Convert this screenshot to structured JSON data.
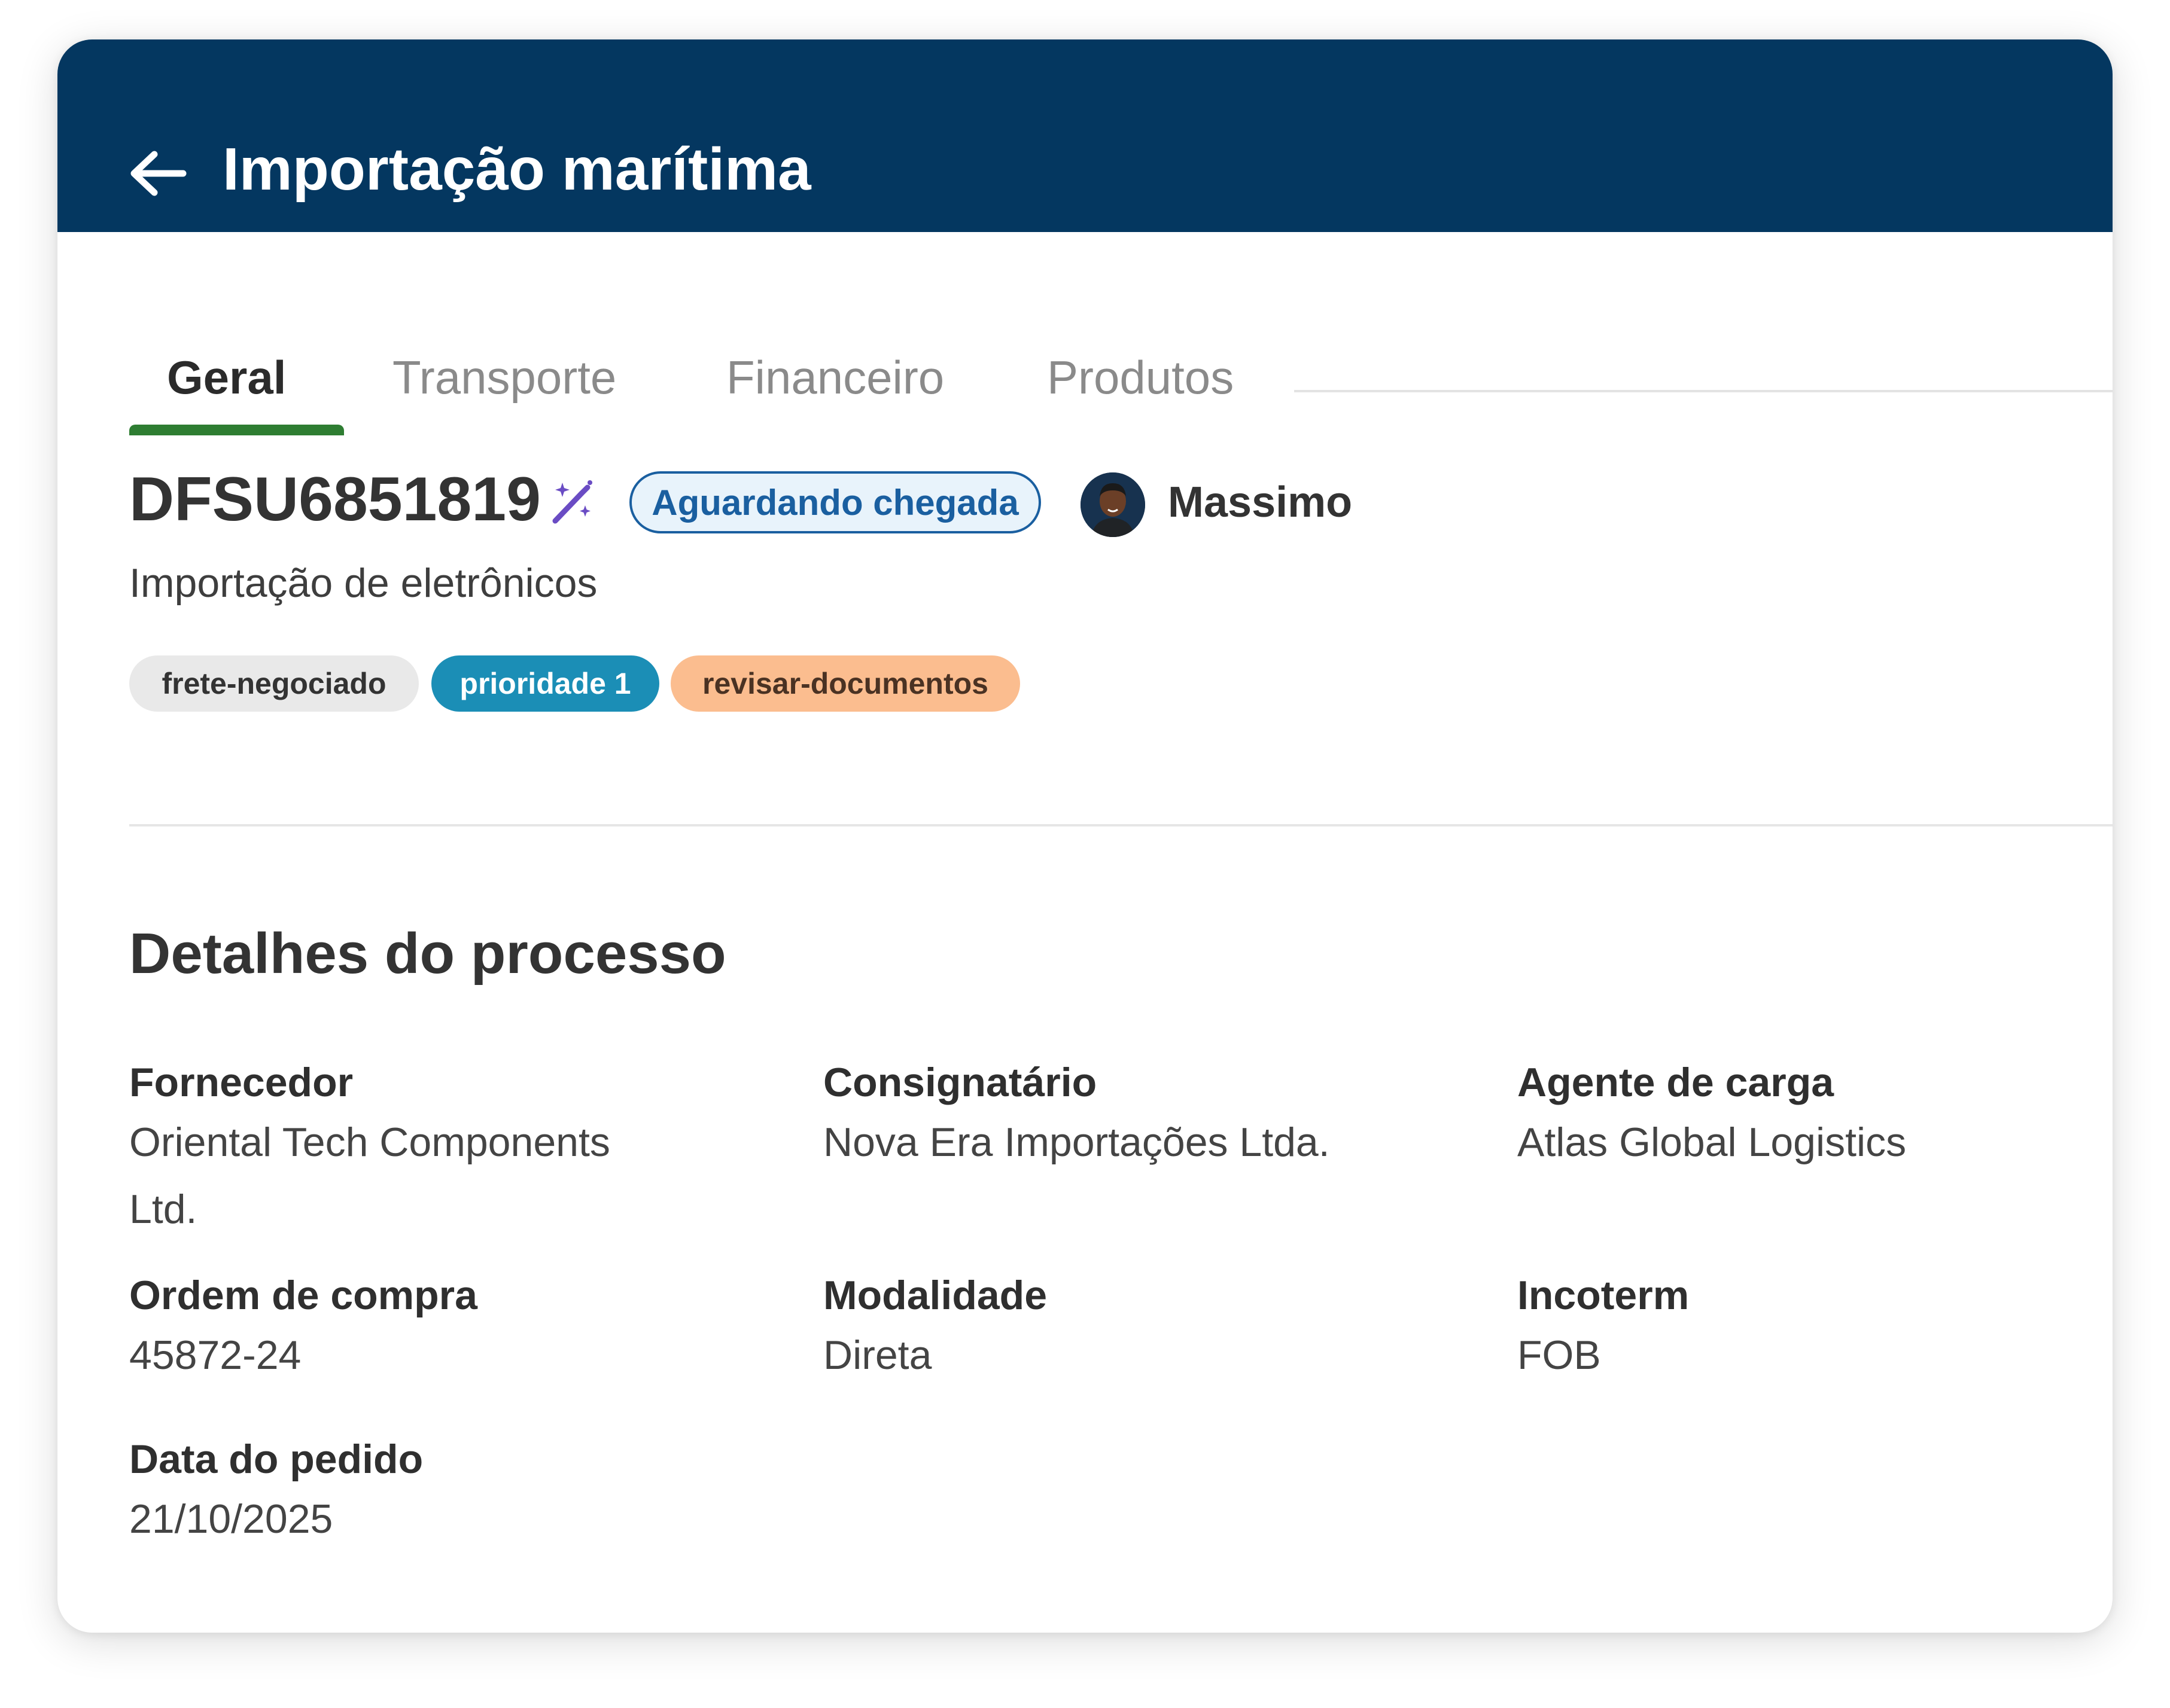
{
  "header": {
    "title": "Importação marítima",
    "back_icon": "arrow-left-icon",
    "background": "#043760"
  },
  "tabs": [
    {
      "label": "Geral",
      "active": true
    },
    {
      "label": "Transporte",
      "active": false
    },
    {
      "label": "Financeiro",
      "active": false
    },
    {
      "label": "Produtos",
      "active": false
    }
  ],
  "process": {
    "id": "DFSU6851819",
    "id_icon": "magic-wand-icon",
    "status": "Aguardando chegada",
    "owner": "Massimo",
    "description": "Importação de eletrônicos",
    "tags": [
      {
        "label": "frete-negociado",
        "color": "#e9e9e9"
      },
      {
        "label": "prioridade 1",
        "color": "#1b8eb6"
      },
      {
        "label": "revisar-documentos",
        "color": "#fbbd8f"
      }
    ]
  },
  "details": {
    "title": "Detalhes do processo",
    "fields": [
      {
        "label": "Fornecedor",
        "value": "Oriental Tech Components Ltd."
      },
      {
        "label": "Consignatário",
        "value": "Nova Era Importações Ltda."
      },
      {
        "label": "Agente de carga",
        "value": "Atlas Global Logistics"
      },
      {
        "label": "Ordem de compra",
        "value": "45872-24"
      },
      {
        "label": "Modalidade",
        "value": "Direta"
      },
      {
        "label": "Incoterm",
        "value": "FOB"
      },
      {
        "label": "Data do pedido",
        "value": "21/10/2025"
      }
    ]
  },
  "colors": {
    "active_tab_indicator": "#2e7d32",
    "status_badge": "#1a5fa0"
  }
}
